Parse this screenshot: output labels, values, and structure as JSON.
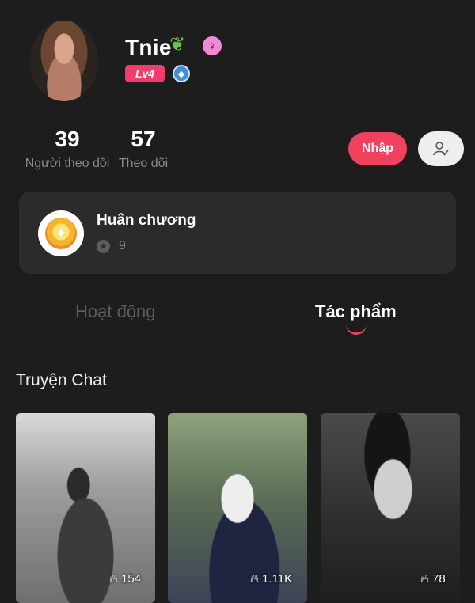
{
  "profile": {
    "username": "Tnie",
    "leaf_icon": "leaf-icon",
    "gender_icon": "female-icon",
    "level": "Lv4",
    "badge_icon": "blue-diamond-badge-icon"
  },
  "stats": [
    {
      "value": "39",
      "label": "Người theo dõi"
    },
    {
      "value": "57",
      "label": "Theo dõi"
    }
  ],
  "actions": {
    "primary_label": "Nhập",
    "secondary_icon": "user-check-icon",
    "accent_color": "#f2405f"
  },
  "medal": {
    "title": "Huân chương",
    "count": "9",
    "icon": "medal-icon"
  },
  "tabs": [
    {
      "label": "Hoạt động",
      "active": false
    },
    {
      "label": "Tác phẩm",
      "active": true
    }
  ],
  "section": {
    "title": "Truyện Chat"
  },
  "works": [
    {
      "count": "154",
      "icon": "fire-icon"
    },
    {
      "count": "1.11K",
      "icon": "fire-icon"
    },
    {
      "count": "78",
      "icon": "fire-icon"
    }
  ]
}
